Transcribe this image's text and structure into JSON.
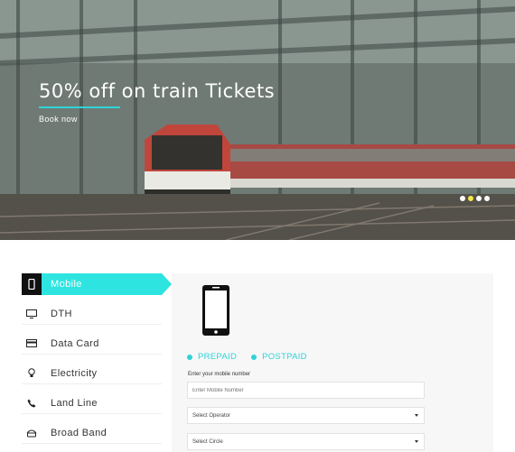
{
  "hero": {
    "title": "50% off on train Tickets",
    "cta": "Book now",
    "slides": 4,
    "active_slide": 2,
    "colors": {
      "accent": "#2fd3d8",
      "active_dot": "#f5e74a"
    }
  },
  "sidebar": {
    "items": [
      {
        "label": "Mobile",
        "icon": "mobile-icon",
        "active": true
      },
      {
        "label": "DTH",
        "icon": "tv-icon",
        "active": false
      },
      {
        "label": "Data Card",
        "icon": "card-icon",
        "active": false
      },
      {
        "label": "Electricity",
        "icon": "bulb-icon",
        "active": false
      },
      {
        "label": "Land Line",
        "icon": "phone-icon",
        "active": false
      },
      {
        "label": "Broad Band",
        "icon": "router-icon",
        "active": false
      }
    ],
    "accent_color": "#2ee4e0"
  },
  "panel": {
    "options": [
      "PREPAID",
      "POSTPAID"
    ],
    "mobile_label": "Enter your mobile number",
    "mobile_placeholder": "Enter Mobile Number",
    "operator_select": "Select Operator",
    "circle_select": "Select Circle"
  }
}
